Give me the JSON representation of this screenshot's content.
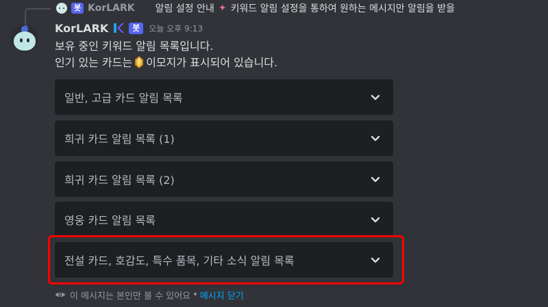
{
  "reply": {
    "bot_tag": "봇",
    "author": "KorLARK",
    "text_before": "알림 설정 안내",
    "text_after": "키워드 알림 설정을 통하여 원하는 메시지만 알림을 받을"
  },
  "message": {
    "author": "KorLARK",
    "bot_tag": "봇",
    "timestamp": "오늘 오후 9:13",
    "line1": "보유 중인 키워드 알림 목록입니다.",
    "line2_before": "인기 있는 카드는",
    "line2_after": "이모지가 표시되어 있습니다."
  },
  "selects": [
    {
      "label": "일반, 고급 카드 알림 목록"
    },
    {
      "label": "희귀 카드 알림 목록 (1)"
    },
    {
      "label": "희귀 카드 알림 목록 (2)"
    },
    {
      "label": "영웅 카드 알림 목록"
    },
    {
      "label": "전설 카드, 호감도, 특수 품목, 기타 소식 알림 목록"
    }
  ],
  "footer": {
    "notice": "이 메시지는 본인만 볼 수 있어요",
    "separator": "•",
    "dismiss": "메시지 닫기"
  },
  "colors": {
    "background": "#313338",
    "select_bg": "#1e1f22",
    "blurple": "#5865f2",
    "link": "#00a8fc",
    "highlight": "#ff0000"
  },
  "icons": {
    "sparkle": "sparkle-icon",
    "gem": "orange-gem-icon",
    "chevron": "chevron-down-icon",
    "eye": "eye-icon"
  }
}
